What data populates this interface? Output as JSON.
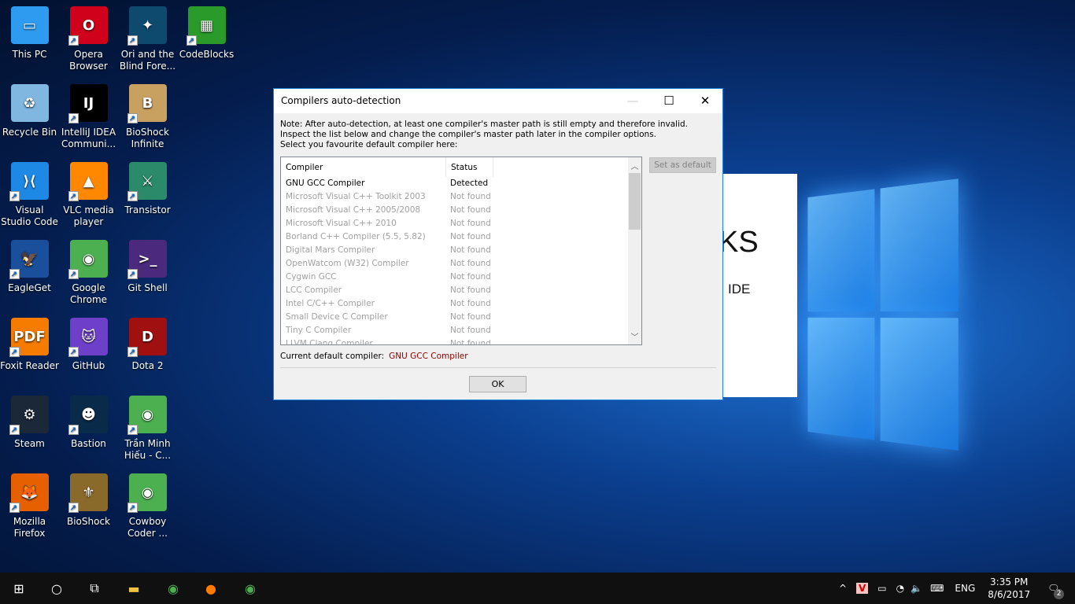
{
  "desktop": {
    "icons": [
      {
        "label": "This PC",
        "color": "#2e9bf0",
        "glyph": "▭",
        "shortcut": false
      },
      {
        "label": "Recycle Bin",
        "color": "#7fb7e0",
        "glyph": "♻",
        "shortcut": false
      },
      {
        "label": "Visual Studio Code",
        "color": "#1e88e5",
        "glyph": "⟩⟨",
        "shortcut": true
      },
      {
        "label": "EagleGet",
        "color": "#1a4f9c",
        "glyph": "🦅",
        "shortcut": true
      },
      {
        "label": "Foxit Reader",
        "color": "#f57c00",
        "glyph": "PDF",
        "shortcut": true
      },
      {
        "label": "Steam",
        "color": "#1b2838",
        "glyph": "⚙",
        "shortcut": true
      },
      {
        "label": "Mozilla Firefox",
        "color": "#e66000",
        "glyph": "🦊",
        "shortcut": true
      },
      {
        "label": "Opera Browser",
        "color": "#d0021b",
        "glyph": "O",
        "shortcut": true
      },
      {
        "label": "IntelliJ IDEA Communi...",
        "color": "#000000",
        "glyph": "IJ",
        "shortcut": true
      },
      {
        "label": "VLC media player",
        "color": "#ff8800",
        "glyph": "▲",
        "shortcut": true
      },
      {
        "label": "Google Chrome",
        "color": "#4caf50",
        "glyph": "◉",
        "shortcut": true
      },
      {
        "label": "GitHub",
        "color": "#6e40c9",
        "glyph": "🐱",
        "shortcut": true
      },
      {
        "label": "Bastion",
        "color": "#0a2a4a",
        "glyph": "☻",
        "shortcut": true
      },
      {
        "label": "BioShock",
        "color": "#8a6a2a",
        "glyph": "⚜",
        "shortcut": true
      },
      {
        "label": "Ori and the Blind Fore...",
        "color": "#0e4a6e",
        "glyph": "✦",
        "shortcut": true
      },
      {
        "label": "BioShock Infinite",
        "color": "#c8a060",
        "glyph": "B",
        "shortcut": true
      },
      {
        "label": "Transistor",
        "color": "#2a8a6a",
        "glyph": "⚔",
        "shortcut": true
      },
      {
        "label": "Git Shell",
        "color": "#4b2a7e",
        "glyph": ">_",
        "shortcut": true
      },
      {
        "label": "Dota 2",
        "color": "#a01010",
        "glyph": "D",
        "shortcut": true
      },
      {
        "label": "Trần Minh Hiếu - C...",
        "color": "#4caf50",
        "glyph": "◉",
        "shortcut": true
      },
      {
        "label": "Cowboy Coder ...",
        "color": "#4caf50",
        "glyph": "◉",
        "shortcut": true
      },
      {
        "label": "CodeBlocks",
        "color": "#2a9a2a",
        "glyph": "▦",
        "shortcut": true
      }
    ]
  },
  "splash": {
    "text1": "KS",
    "text2": "IDE"
  },
  "dialog": {
    "title": "Compilers auto-detection",
    "note": "Note: After auto-detection, at least one compiler's master path is still empty and therefore invalid.\nInspect the list below and change the compiler's master path later in the compiler options.\nSelect you favourite default compiler here:",
    "columns": [
      "Compiler",
      "Status"
    ],
    "rows": [
      {
        "compiler": "GNU GCC Compiler",
        "status": "Detected"
      },
      {
        "compiler": "Microsoft Visual C++ Toolkit 2003",
        "status": "Not found"
      },
      {
        "compiler": "Microsoft Visual C++ 2005/2008",
        "status": "Not found"
      },
      {
        "compiler": "Microsoft Visual C++ 2010",
        "status": "Not found"
      },
      {
        "compiler": "Borland C++ Compiler (5.5, 5.82)",
        "status": "Not found"
      },
      {
        "compiler": "Digital Mars Compiler",
        "status": "Not found"
      },
      {
        "compiler": "OpenWatcom (W32) Compiler",
        "status": "Not found"
      },
      {
        "compiler": "Cygwin GCC",
        "status": "Not found"
      },
      {
        "compiler": "LCC Compiler",
        "status": "Not found"
      },
      {
        "compiler": "Intel C/C++ Compiler",
        "status": "Not found"
      },
      {
        "compiler": "Small Device C Compiler",
        "status": "Not found"
      },
      {
        "compiler": "Tiny C Compiler",
        "status": "Not found"
      },
      {
        "compiler": "LLVM Clang Compiler",
        "status": "Not found"
      }
    ],
    "set_default_label": "Set as default",
    "current_label": "Current default compiler:",
    "current_value": "GNU GCC Compiler",
    "ok_label": "OK"
  },
  "taskbar": {
    "language": "ENG",
    "time": "3:35 PM",
    "date": "8/6/2017",
    "notifications": "2"
  }
}
